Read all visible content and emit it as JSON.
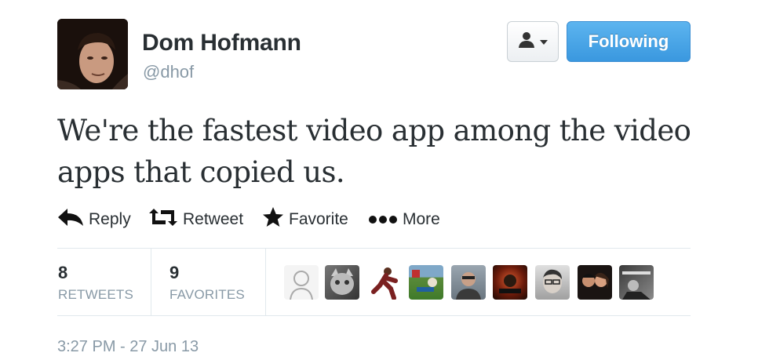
{
  "user": {
    "name": "Dom Hofmann",
    "handle": "@dhof"
  },
  "buttons": {
    "follow_label": "Following"
  },
  "tweet": {
    "text": "We're the fastest video app among the video apps that copied us.",
    "timestamp": "3:27 PM - 27 Jun 13"
  },
  "actions": [
    {
      "label": "Reply",
      "icon": "reply-icon"
    },
    {
      "label": "Retweet",
      "icon": "retweet-icon"
    },
    {
      "label": "Favorite",
      "icon": "star-icon"
    },
    {
      "label": "More",
      "icon": "more-dots-icon"
    }
  ],
  "stats": {
    "retweets": {
      "count": "8",
      "label": "RETWEETS"
    },
    "favorites": {
      "count": "9",
      "label": "FAVORITES"
    }
  },
  "favoriters_avatars": 9,
  "colors": {
    "accent": "#4aa6e8",
    "text": "#292f33",
    "muted": "#8899a6",
    "divider": "#e1e8ed"
  }
}
